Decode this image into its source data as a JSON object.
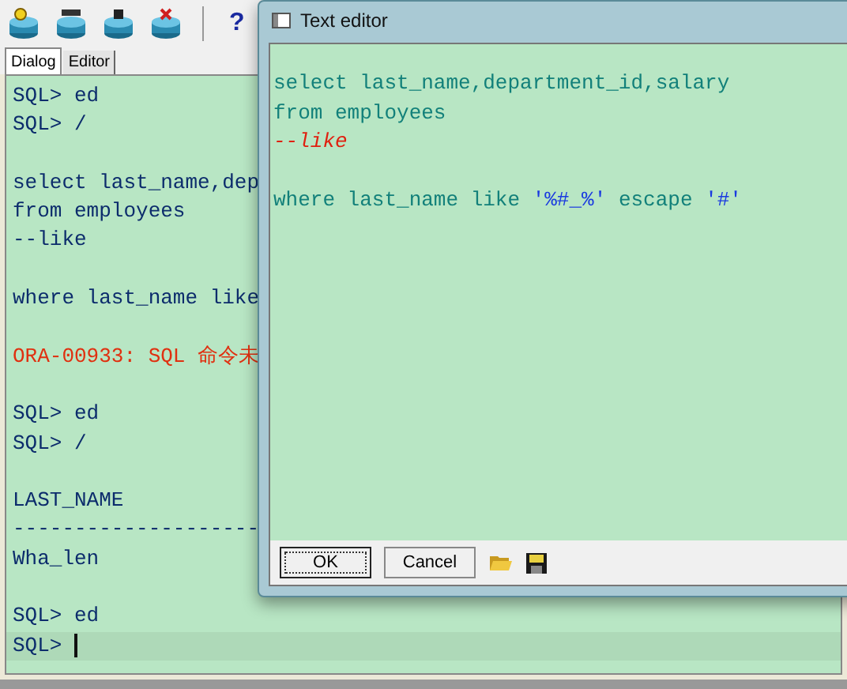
{
  "toolbar": {
    "help_label": "?"
  },
  "tabs": [
    {
      "label": "Dialog",
      "selected": true
    },
    {
      "label": "Editor",
      "selected": false
    }
  ],
  "console": {
    "lines": [
      {
        "kind": "text",
        "text": "SQL> ed"
      },
      {
        "kind": "text",
        "text": "SQL> /"
      },
      {
        "kind": "blank"
      },
      {
        "kind": "text",
        "text": "select last_name,dep"
      },
      {
        "kind": "text",
        "text": "from employees"
      },
      {
        "kind": "text",
        "text": "--like"
      },
      {
        "kind": "blank"
      },
      {
        "kind": "text",
        "text": "where last_name like"
      },
      {
        "kind": "blank"
      },
      {
        "kind": "error",
        "text": "ORA-00933: SQL 命令未"
      },
      {
        "kind": "blank"
      },
      {
        "kind": "text",
        "text": "SQL> ed"
      },
      {
        "kind": "text",
        "text": "SQL> /"
      },
      {
        "kind": "blank"
      },
      {
        "kind": "text",
        "text": "LAST_NAME"
      },
      {
        "kind": "text",
        "text": "--------------------"
      },
      {
        "kind": "text",
        "text": "Wha_len"
      },
      {
        "kind": "blank"
      },
      {
        "kind": "text",
        "text": "SQL> ed"
      },
      {
        "kind": "current",
        "text": "SQL>"
      }
    ]
  },
  "editor": {
    "title": "Text editor",
    "lines": [
      {
        "kind": "code",
        "segments": [
          {
            "kind": "plain",
            "text": "select last_name,department_id,salary"
          }
        ]
      },
      {
        "kind": "code",
        "segments": [
          {
            "kind": "plain",
            "text": "from employees"
          }
        ]
      },
      {
        "kind": "code",
        "segments": [
          {
            "kind": "comment",
            "text": "--like"
          }
        ]
      },
      {
        "kind": "blank"
      },
      {
        "kind": "code",
        "segments": [
          {
            "kind": "plain",
            "text": "where last_name like "
          },
          {
            "kind": "string",
            "text": "'%#_%'"
          },
          {
            "kind": "plain",
            "text": " escape "
          },
          {
            "kind": "string",
            "text": "'#'"
          }
        ]
      }
    ],
    "buttons": [
      {
        "label": "OK",
        "selected": true
      },
      {
        "label": "Cancel",
        "selected": false
      }
    ]
  }
}
